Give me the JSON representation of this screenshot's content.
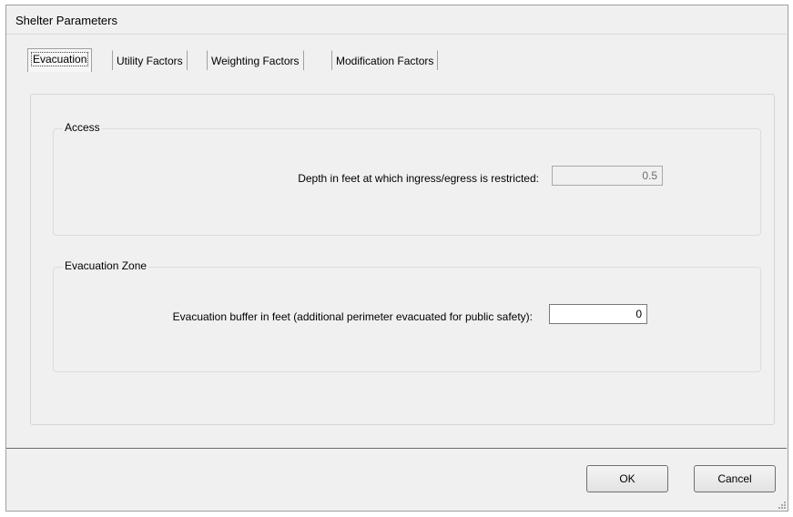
{
  "window": {
    "title": "Shelter Parameters"
  },
  "tabs": [
    {
      "label": "Evacuation",
      "active": true
    },
    {
      "label": "Utility Factors",
      "active": false
    },
    {
      "label": "Weighting Factors",
      "active": false
    },
    {
      "label": "Modification Factors",
      "active": false
    }
  ],
  "access": {
    "title": "Access",
    "depth_label": "Depth in feet at which ingress/egress is restricted:",
    "depth_value": "0.5"
  },
  "evac_zone": {
    "title": "Evacuation Zone",
    "buffer_label": "Evacuation buffer in feet (additional perimeter evacuated for public safety):",
    "buffer_value": "0"
  },
  "buttons": {
    "ok": "OK",
    "cancel": "Cancel"
  }
}
